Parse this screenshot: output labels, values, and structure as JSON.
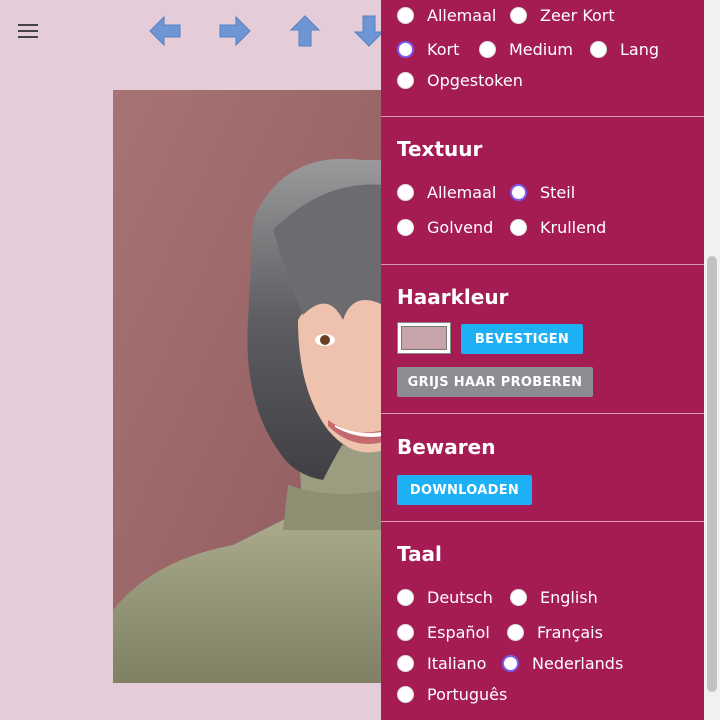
{
  "toolbar": {
    "menu_icon": "hamburger-menu-icon",
    "arrows": [
      "arrow-left-icon",
      "arrow-right-icon",
      "arrow-up-icon",
      "arrow-down-icon"
    ],
    "arrow_color": "#6f96d4"
  },
  "panel": {
    "length": {
      "options": [
        "Allemaal",
        "Zeer Kort",
        "Kort",
        "Medium",
        "Lang",
        "Opgestoken"
      ],
      "selected": "Kort"
    },
    "texture": {
      "title": "Textuur",
      "options": [
        "Allemaal",
        "Steil",
        "Golvend",
        "Krullend"
      ],
      "selected": "Steil"
    },
    "hair_color": {
      "title": "Haarkleur",
      "swatch_color": "#c9a4ab",
      "confirm_label": "BEVESTIGEN",
      "grey_label": "GRIJS HAAR PROBEREN"
    },
    "save": {
      "title": "Bewaren",
      "download_label": "DOWNLOADEN"
    },
    "language": {
      "title": "Taal",
      "options": [
        "Deutsch",
        "English",
        "Español",
        "Français",
        "Italiano",
        "Nederlands",
        "Português"
      ],
      "selected": "Nederlands"
    },
    "background_color": "#a51c54",
    "accent_color": "#7b5cf0"
  }
}
